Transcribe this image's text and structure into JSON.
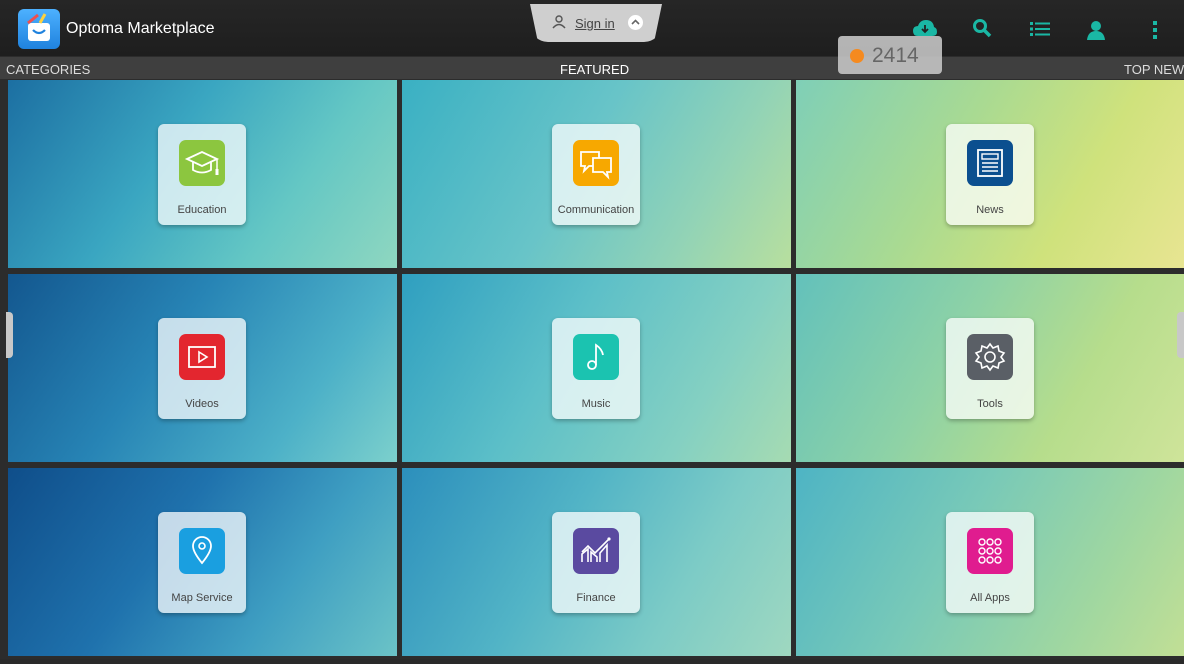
{
  "header": {
    "app_title": "Optoma Marketplace",
    "sign_in_label": "Sign in",
    "icons": [
      "cloud-download-icon",
      "search-icon",
      "list-icon",
      "account-icon",
      "more-vertical-icon"
    ],
    "accent_color": "#1ab7a4"
  },
  "nav": {
    "left_label": "CATEGORIES",
    "center_label": "FEATURED",
    "right_label": "TOP NEW"
  },
  "badge": {
    "value": "2414",
    "dot_color": "#f58a1f"
  },
  "categories": [
    {
      "label": "Education",
      "icon": "graduation-cap-icon",
      "color": "#8cc63f"
    },
    {
      "label": "Communication",
      "icon": "chat-bubbles-icon",
      "color": "#f7a800"
    },
    {
      "label": "News",
      "icon": "newspaper-icon",
      "color": "#0b4f8f"
    },
    {
      "label": "Videos",
      "icon": "play-icon",
      "color": "#e3262f"
    },
    {
      "label": "Music",
      "icon": "music-note-icon",
      "color": "#1bc3b0"
    },
    {
      "label": "Tools",
      "icon": "gear-icon",
      "color": "#5a5f66"
    },
    {
      "label": "Map Service",
      "icon": "map-pin-icon",
      "color": "#1a9fe0"
    },
    {
      "label": "Finance",
      "icon": "chart-icon",
      "color": "#5a4aa0"
    },
    {
      "label": "All Apps",
      "icon": "grid-icon",
      "color": "#e01c8f"
    }
  ]
}
